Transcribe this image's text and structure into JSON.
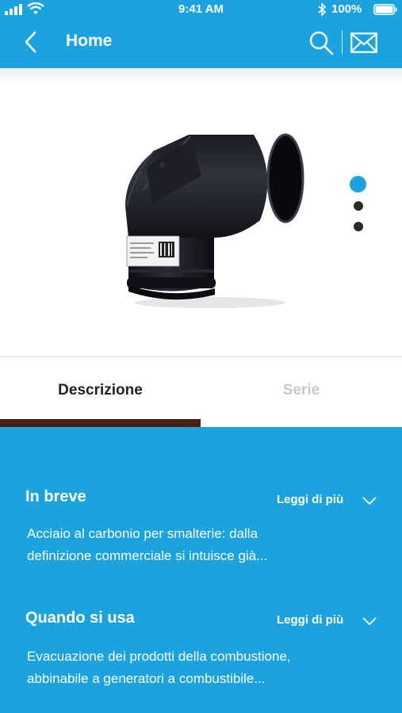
{
  "status_bar": {
    "time": "9:41 AM",
    "battery": "100%"
  },
  "nav": {
    "title": "Home",
    "icons": [
      "back-chevron-icon",
      "search-icon",
      "mail-icon"
    ]
  },
  "gallery": {
    "image": "black-carbon-steel-pipe-elbow",
    "slide_count": 3,
    "active_slide": 1
  },
  "tabs": [
    {
      "label": "Descrizione",
      "active": true
    },
    {
      "label": "Serie",
      "active": false
    }
  ],
  "sections": [
    {
      "title": "In breve",
      "more": "Leggi di più",
      "lines": [
        "Acciaio al carbonio per smalterie: dalla",
        "definizione commerciale si intuisce già..."
      ]
    },
    {
      "title": "Quando si usa",
      "more": "Leggi di più",
      "lines": [
        "Evacuazione dei prodotti della combustione,",
        "abbinabile a generatori a combustibile..."
      ]
    }
  ],
  "colors": {
    "primary": "#1ba3e0",
    "tab_indicator": "#4a1f12",
    "inactive_tab": "#c8c8c8",
    "dot": "#2a2a2a"
  }
}
